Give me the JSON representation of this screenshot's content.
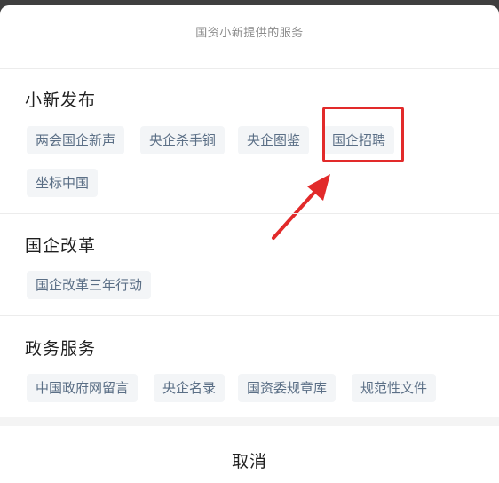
{
  "header": {
    "title": "国资小新提供的服务"
  },
  "sections": [
    {
      "title": "小新发布",
      "chips": [
        "两会国企新声",
        "央企杀手锏",
        "央企图鉴",
        "国企招聘",
        "坐标中国"
      ]
    },
    {
      "title": "国企改革",
      "chips": [
        "国企改革三年行动"
      ]
    },
    {
      "title": "政务服务",
      "chips": [
        "中国政府网留言",
        "央企名录",
        "国资委规章库",
        "规范性文件"
      ]
    }
  ],
  "cancel": {
    "label": "取消"
  },
  "colors": {
    "chip_bg": "#f3f5f7",
    "chip_text": "#5b6f86",
    "highlight": "#e22a2a"
  }
}
